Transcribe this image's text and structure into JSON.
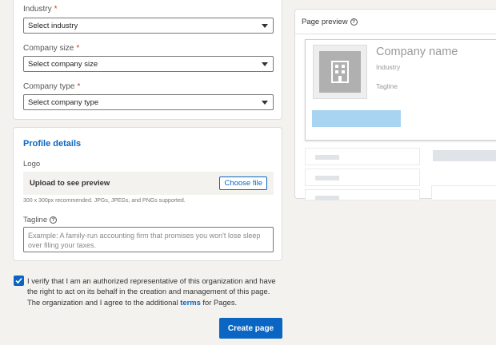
{
  "form": {
    "industry": {
      "label": "Industry",
      "required_mark": "*",
      "value": "Select industry"
    },
    "company_size": {
      "label": "Company size",
      "required_mark": "*",
      "value": "Select company size"
    },
    "company_type": {
      "label": "Company type",
      "required_mark": "*",
      "value": "Select company type"
    }
  },
  "profile": {
    "title": "Profile details",
    "logo_label": "Logo",
    "upload_text": "Upload to see preview",
    "choose_file": "Choose file",
    "hint": "300 x 300px recommended. JPGs, JPEGs, and PNGs supported.",
    "tagline_label": "Tagline",
    "tagline_placeholder": "Example: A family-run accounting firm that promises you won't lose sleep over filing your taxes."
  },
  "verify": {
    "checked": true,
    "text_before": "I verify that I am an authorized representative of this organization and have the right to act on its behalf in the creation and management of this page. The organization and I agree to the additional ",
    "link": "terms",
    "text_after": " for Pages."
  },
  "create_button": "Create page",
  "preview": {
    "header": "Page preview",
    "company_name": "Company name",
    "industry": "Industry",
    "tagline": "Tagline"
  },
  "colors": {
    "accent": "#0a66c2",
    "preview_button": "#a8d4f2",
    "required": "#b24020"
  },
  "icons": {
    "help": "question-circle-icon",
    "dropdown": "caret-down-icon",
    "check": "checkmark-icon",
    "logo_placeholder": "building-icon"
  }
}
